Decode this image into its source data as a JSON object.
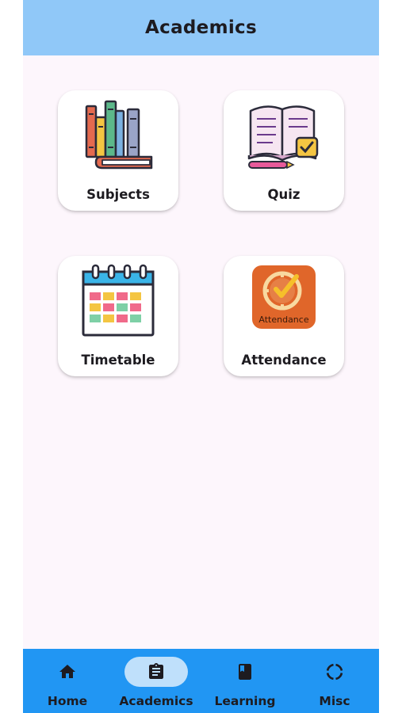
{
  "app_bar": {
    "title": "Academics"
  },
  "tiles": [
    {
      "label": "Subjects",
      "icon": "books-icon"
    },
    {
      "label": "Quiz",
      "icon": "open-book-check-icon"
    },
    {
      "label": "Timetable",
      "icon": "calendar-icon"
    },
    {
      "label": "Attendance",
      "icon": "attendance-clock-icon",
      "icon_text": "Attendance"
    }
  ],
  "bottom_nav": {
    "active": "Academics",
    "items": [
      {
        "label": "Home",
        "icon": "home-icon"
      },
      {
        "label": "Academics",
        "icon": "clipboard-icon"
      },
      {
        "label": "Learning",
        "icon": "book-icon"
      },
      {
        "label": "Misc",
        "icon": "circle-dashed-icon"
      }
    ]
  },
  "colors": {
    "app_bar": "#90c8f8",
    "background": "#fdf6fc",
    "bottom_nav": "#2196f3",
    "active_pill": "#bfe0fb",
    "text": "#1d1b20"
  }
}
